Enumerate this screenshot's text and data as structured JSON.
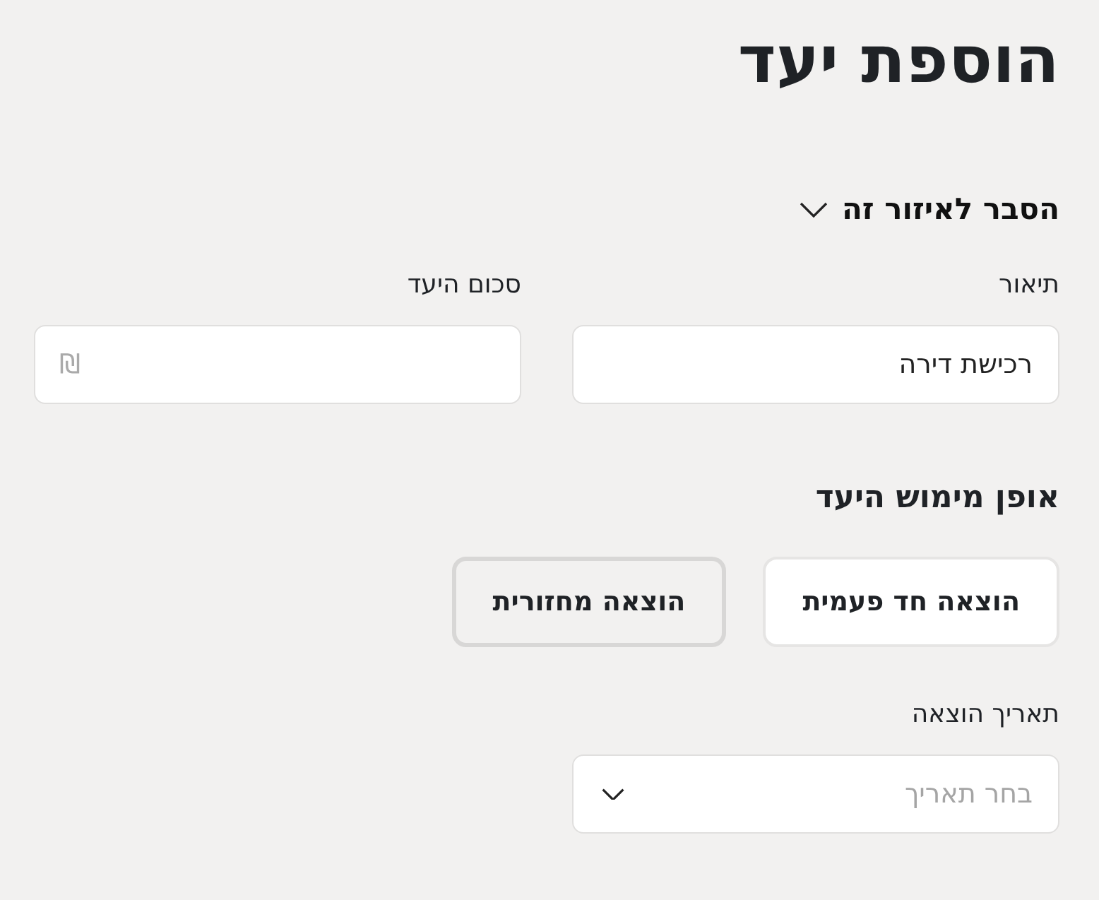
{
  "title": "הוספת יעד",
  "explainer": {
    "label": "הסבר לאיזור זה",
    "expanded": false
  },
  "fields": [
    {
      "label": "תיאור",
      "value": "רכישת דירה"
    },
    {
      "label": "סכום היעד",
      "currency": "₪"
    }
  ],
  "method": {
    "heading": "אופן מימוש היעד",
    "options": [
      {
        "label": "הוצאה חד פעמית",
        "selected": true
      },
      {
        "label": "הוצאה מחזורית",
        "selected": false
      }
    ]
  },
  "date": {
    "label": "תאריך הוצאה",
    "placeholder": "בחר תאריך"
  }
}
